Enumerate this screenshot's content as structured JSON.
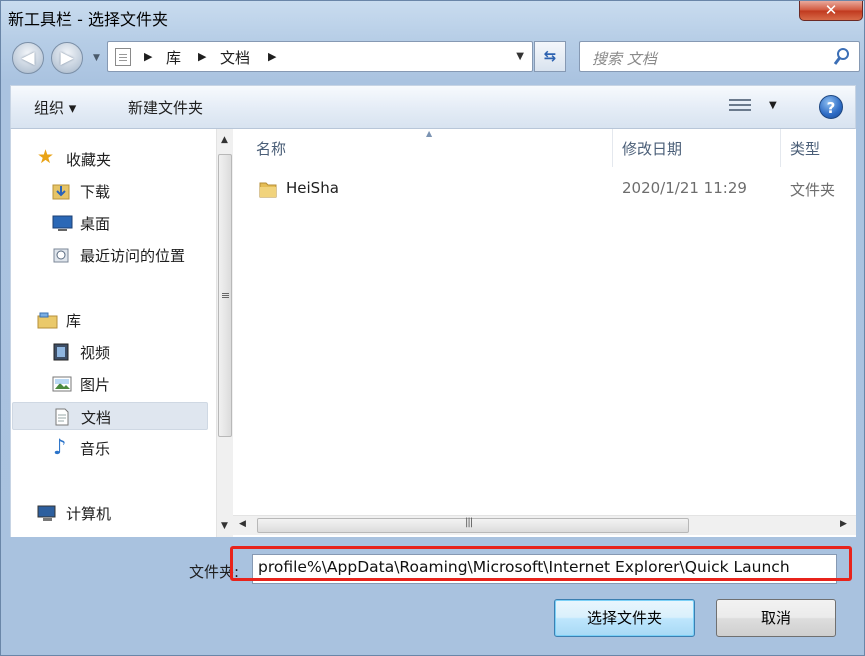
{
  "window": {
    "title": "新工具栏 - 选择文件夹",
    "close_label": "✕"
  },
  "nav": {
    "back_label": "◀",
    "forward_label": "▶",
    "breadcrumbs": [
      "库",
      "文档"
    ],
    "search_placeholder": "搜索 文档"
  },
  "toolbar": {
    "organize_label": "组织 ▾",
    "new_folder_label": "新建文件夹",
    "help_label": "?"
  },
  "navpane": {
    "favorites": {
      "label": "收藏夹",
      "items": [
        "下载",
        "桌面",
        "最近访问的位置"
      ]
    },
    "libraries": {
      "label": "库",
      "items": [
        "视频",
        "图片",
        "文档",
        "音乐"
      ],
      "selected": "文档"
    },
    "computer": {
      "label": "计算机"
    }
  },
  "filelist": {
    "columns": [
      "名称",
      "修改日期",
      "类型"
    ],
    "rows": [
      {
        "name": "HeiSha",
        "modified": "2020/1/21 11:29",
        "type": "文件夹"
      }
    ]
  },
  "footer": {
    "folder_label": "文件夹:",
    "folder_value": "profile%\\AppData\\Roaming\\Microsoft\\Internet Explorer\\Quick Launch",
    "select_button": "选择文件夹",
    "cancel_button": "取消"
  },
  "colors": {
    "highlight": "#e8231b",
    "selection": "#dfe6ef"
  }
}
